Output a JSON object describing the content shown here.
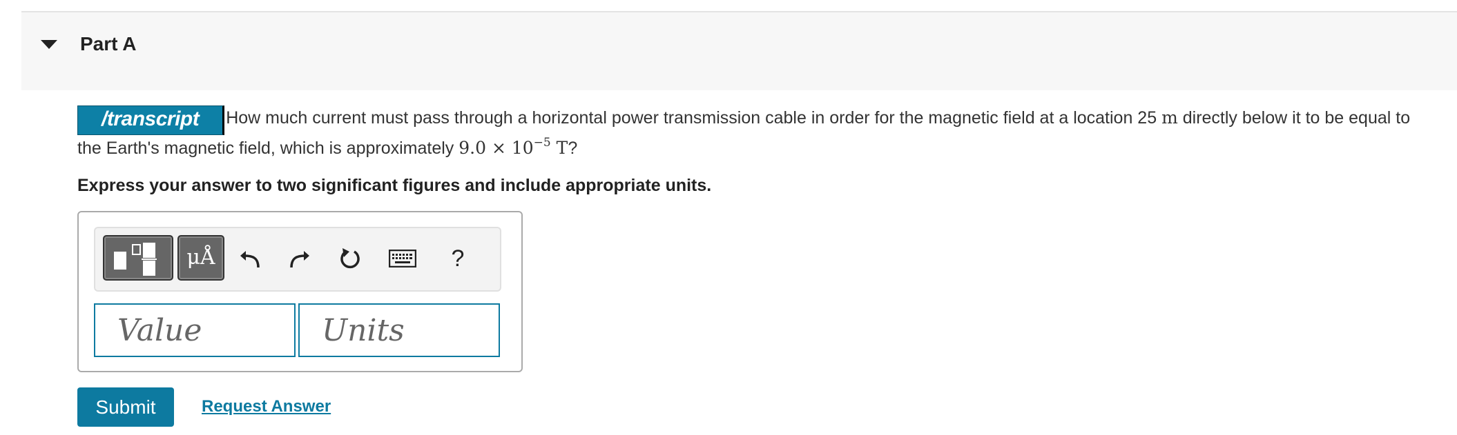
{
  "part": {
    "title": "Part A"
  },
  "question": {
    "badge": "transcript",
    "text_before": "How much current must pass through a horizontal power transmission cable in order for the magnetic field at a location 25 ",
    "unit_m": "m",
    "text_middle": " directly below it to be equal to the Earth's magnetic field, which is approximately ",
    "math_value": "9.0 × 10",
    "math_exp": "−5",
    "math_unit": " T",
    "text_after": "?"
  },
  "instruction": "Express your answer to two significant figures and include appropriate units.",
  "toolbar": {
    "units_label": "μÅ",
    "help_label": "?",
    "icons": [
      "templates-icon",
      "units-icon",
      "undo-icon",
      "redo-icon",
      "reset-icon",
      "keyboard-icon",
      "help-icon"
    ]
  },
  "inputs": {
    "value_placeholder": "Value",
    "units_placeholder": "Units"
  },
  "actions": {
    "submit_label": "Submit",
    "request_label": "Request Answer"
  },
  "colors": {
    "accent": "#0d7aa0",
    "header_bg": "#f7f7f7"
  }
}
